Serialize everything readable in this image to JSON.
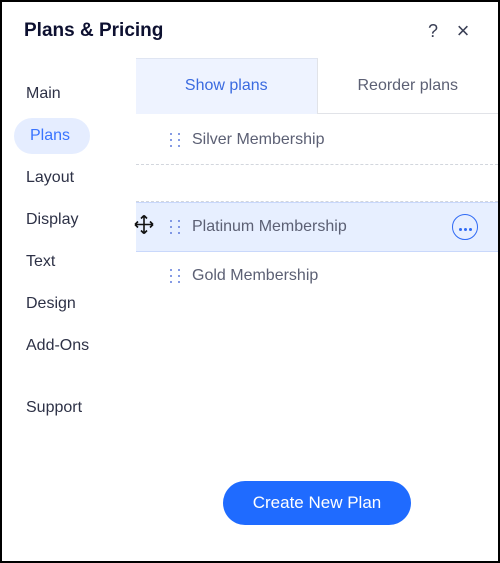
{
  "header": {
    "title": "Plans & Pricing",
    "help_label": "?",
    "close_label": "×"
  },
  "sidebar": {
    "items": [
      {
        "label": "Main",
        "active": false
      },
      {
        "label": "Plans",
        "active": true
      },
      {
        "label": "Layout",
        "active": false
      },
      {
        "label": "Display",
        "active": false
      },
      {
        "label": "Text",
        "active": false
      },
      {
        "label": "Design",
        "active": false
      },
      {
        "label": "Add-Ons",
        "active": false
      }
    ],
    "footer_item": {
      "label": "Support"
    }
  },
  "tabs": [
    {
      "label": "Show plans",
      "active": true
    },
    {
      "label": "Reorder plans",
      "active": false
    }
  ],
  "plans": [
    {
      "label": "Silver Membership",
      "state": "normal"
    },
    {
      "label": "Platinum Membership",
      "state": "dragging"
    },
    {
      "label": "Gold Membership",
      "state": "normal"
    }
  ],
  "cta": {
    "label": "Create New Plan"
  },
  "colors": {
    "accent": "#1f6bff",
    "highlight_bg": "#e7efff",
    "sidebar_active_bg": "#e5edff"
  }
}
